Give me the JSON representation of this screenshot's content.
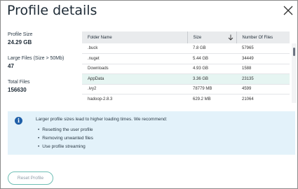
{
  "dialog": {
    "title": "Profile details",
    "close_icon": "close-icon"
  },
  "stats": [
    {
      "label": "Profile Size",
      "value": "24.29 GB"
    },
    {
      "label": "Large Files (Size > 50Mb)",
      "value": "47"
    },
    {
      "label": "Total Files",
      "value": "156630"
    }
  ],
  "table": {
    "headers": {
      "folder": "Folder Name",
      "size": "Size",
      "files": "Number Of Files"
    },
    "sort_icon": "arrow-down-icon",
    "rows": [
      {
        "folder": ".buck",
        "size": "7.8 GB",
        "files": "57965"
      },
      {
        "folder": ".nuget",
        "size": "5.44 GB",
        "files": "34449"
      },
      {
        "folder": "Downloads",
        "size": "4.93 GB",
        "files": "1588"
      },
      {
        "folder": "AppData",
        "size": "3.36 GB",
        "files": "23135"
      },
      {
        "folder": ".ivy2",
        "size": "78779 MB",
        "files": "4599"
      },
      {
        "folder": "hadoop-2.8.3",
        "size": "629.2 MB",
        "files": "21064"
      }
    ],
    "highlighted_row": 3
  },
  "info": {
    "icon": "info-icon",
    "message": "Larger profile sizes lead to higher loading times. We recommend:",
    "items": [
      "Resetting the user profile",
      "Removing unwanted files",
      "Use profile streaming"
    ]
  },
  "actions": {
    "reset_label": "Reset Profile"
  },
  "colors": {
    "info_bg": "#e3f2fa",
    "info_icon": "#1f5fa8",
    "row_highlight": "#e6f5f2",
    "button_border": "#6fbfb5"
  }
}
